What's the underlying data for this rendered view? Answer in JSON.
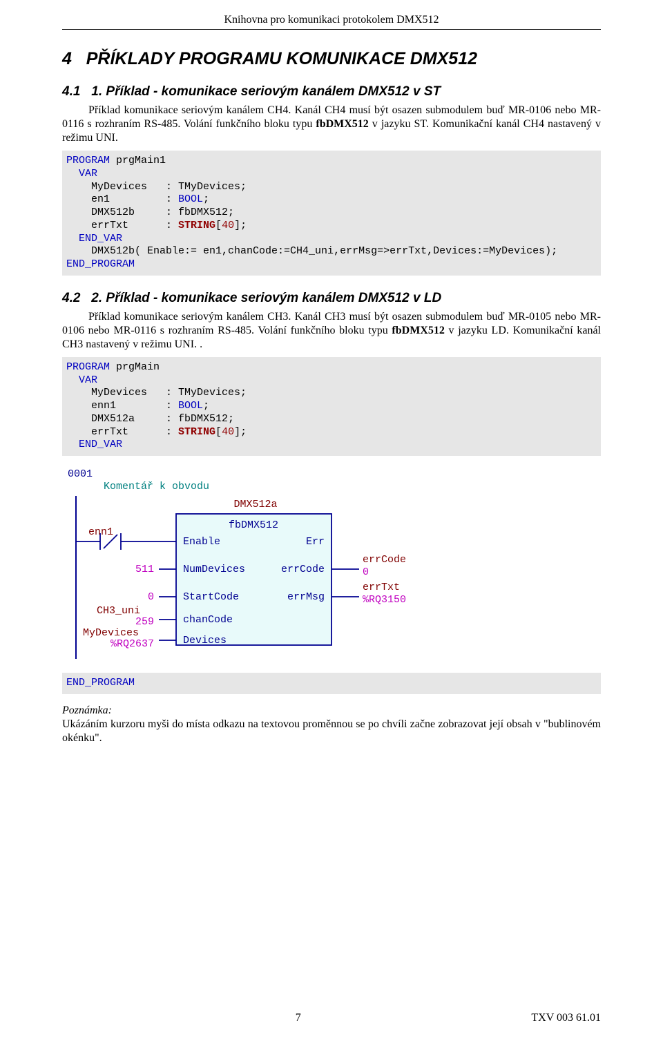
{
  "doc_header": "Knihovna  pro komunikaci protokolem DMX512",
  "sections": {
    "s4": {
      "num": "4",
      "title": "PŘÍKLADY  PROGRAMU KOMUNIKACE DMX512"
    },
    "s41": {
      "num": "4.1",
      "enum": "1.",
      "title": "Příklad  - komunikace seriovým kanálem DMX512 v ST",
      "p1": "Příklad komunikace seriovým kanálem CH4. Kanál CH4 musí být osazen submodulem buď MR-0106 nebo MR-0116 s rozhraním RS-485. Volání funkčního bloku typu ",
      "p1_bold": "fbDMX512",
      "p1_tail": " v jazyku ST. Komunikační kanál CH4  nastavený v režimu UNI."
    },
    "code1": {
      "l1a": "PROGRAM",
      "l1b": " prgMain1",
      "l2a": "  VAR",
      "l3a": "    MyDevices   : TMyDevices;",
      "l4a": "    en1         : ",
      "l4b": "BOOL",
      "l4c": ";",
      "l5a": "    DMX512b     : fbDMX512;",
      "l6a": "    errTxt      : ",
      "l6b": "STRING",
      "l6c": "[",
      "l6d": "40",
      "l6e": "];",
      "l7a": "  END_VAR",
      "l8a": "    DMX512b( Enable:= en1,chanCode:=CH4_uni,errMsg=>errTxt,Devices:=MyDevices);",
      "l9a": "END_PROGRAM"
    },
    "s42": {
      "num": "4.2",
      "enum": "2.",
      "title": "Příklad  - komunikace seriovým kanálem DMX512 v LD",
      "p1": "Příklad komunikace seriovým kanálem CH3. Kanál CH3 musí být osazen submodulem buď MR-0105 nebo MR-0106 nebo MR-0116 s rozhraním RS-485. Volání funkčního bloku typu ",
      "p1_bold": "fbDMX512",
      "p1_tail": " v jazyku LD. Komunikační kanál CH3  nastavený v režimu UNI. ."
    },
    "code2": {
      "l1a": "PROGRAM",
      "l1b": " prgMain",
      "l2a": "  VAR",
      "l3a": "    MyDevices   : TMyDevices;",
      "l4a": "    enn1        : ",
      "l4b": "BOOL",
      "l4c": ";",
      "l5a": "    DMX512a     : fbDMX512;",
      "l6a": "    errTxt      : ",
      "l6b": "STRING",
      "l6c": "[",
      "l6d": "40",
      "l6e": "];",
      "l7a": "  END_VAR"
    },
    "code3": {
      "l1a": "END_PROGRAM"
    }
  },
  "ld": {
    "net_num": "0001",
    "comment": "Komentář k obvodu",
    "instance": "DMX512a",
    "type": "fbDMX512",
    "left": {
      "en1": "enn1",
      "num_devices_val": "511",
      "start_code_val": "0",
      "chan_code_src": "CH3_uni",
      "chan_code_val": "259",
      "devices_src": "MyDevices",
      "devices_addr": "%RQ2637"
    },
    "pins_left": {
      "enable": "Enable",
      "num_devices": "NumDevices",
      "start_code": "StartCode",
      "chan_code": "chanCode",
      "devices": "Devices"
    },
    "pins_right": {
      "err": "Err",
      "err_code": "errCode",
      "err_msg": "errMsg"
    },
    "right": {
      "err_code_dst": "errCode",
      "err_code_val": "0",
      "err_msg_dst": "errTxt",
      "err_msg_addr": "%RQ3150"
    }
  },
  "note": {
    "label": "Poznámka:",
    "text": "Ukázáním kurzoru myši do místa odkazu na textovou proměnnou se po chvíli začne zobrazovat její obsah  v \"bublinovém okénku\"."
  },
  "footer": {
    "page": "7",
    "docnum": "TXV 003 61.01"
  }
}
